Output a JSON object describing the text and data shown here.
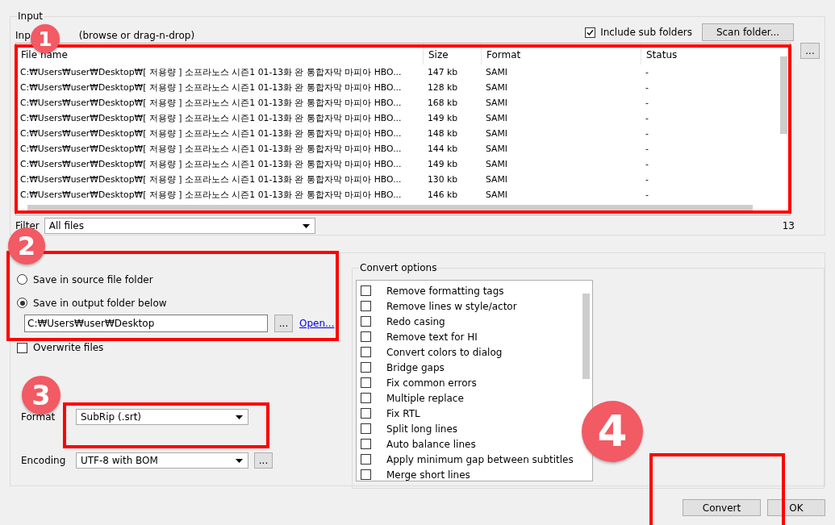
{
  "input": {
    "title": "Input",
    "label_start": "Inp",
    "label_end": "(browse or drag-n-drop)",
    "include_sub_folders": {
      "label": "Include sub folders",
      "checked": true
    },
    "scan_button": "Scan folder...",
    "browse_button": "...",
    "table": {
      "columns": [
        "File name",
        "Size",
        "Format",
        "Status"
      ],
      "rows": [
        {
          "name": "C:₩Users₩user₩Desktop₩[ 저용량 ] 소프라노스 시즌1 01-13화 완 통합자막 마피아 HBO...",
          "size": "147 kb",
          "format": "SAMI",
          "status": "-"
        },
        {
          "name": "C:₩Users₩user₩Desktop₩[ 저용량 ] 소프라노스 시즌1 01-13화 완 통합자막 마피아 HBO...",
          "size": "128 kb",
          "format": "SAMI",
          "status": "-"
        },
        {
          "name": "C:₩Users₩user₩Desktop₩[ 저용량 ] 소프라노스 시즌1 01-13화 완 통합자막 마피아 HBO...",
          "size": "168 kb",
          "format": "SAMI",
          "status": "-"
        },
        {
          "name": "C:₩Users₩user₩Desktop₩[ 저용량 ] 소프라노스 시즌1 01-13화 완 통합자막 마피아 HBO...",
          "size": "149 kb",
          "format": "SAMI",
          "status": "-"
        },
        {
          "name": "C:₩Users₩user₩Desktop₩[ 저용량 ] 소프라노스 시즌1 01-13화 완 통합자막 마피아 HBO...",
          "size": "148 kb",
          "format": "SAMI",
          "status": "-"
        },
        {
          "name": "C:₩Users₩user₩Desktop₩[ 저용량 ] 소프라노스 시즌1 01-13화 완 통합자막 마피아 HBO...",
          "size": "144 kb",
          "format": "SAMI",
          "status": "-"
        },
        {
          "name": "C:₩Users₩user₩Desktop₩[ 저용량 ] 소프라노스 시즌1 01-13화 완 통합자막 마피아 HBO...",
          "size": "149 kb",
          "format": "SAMI",
          "status": "-"
        },
        {
          "name": "C:₩Users₩user₩Desktop₩[ 저용량 ] 소프라노스 시즌1 01-13화 완 통합자막 마피아 HBO...",
          "size": "130 kb",
          "format": "SAMI",
          "status": "-"
        },
        {
          "name": "C:₩Users₩user₩Desktop₩[ 저용량 ] 소프라노스 시즌1 01-13화 완 통합자막 마피아 HBO...",
          "size": "146 kb",
          "format": "SAMI",
          "status": "-"
        }
      ]
    },
    "filter": {
      "label": "Filter",
      "value": "All files"
    },
    "count": "13"
  },
  "output": {
    "radios": [
      {
        "label": "Save in source file folder",
        "selected": false
      },
      {
        "label": "Save in output folder below",
        "selected": true
      }
    ],
    "folder": "C:₩Users₩user₩Desktop",
    "browse_button": "...",
    "open_link": "Open...",
    "overwrite": {
      "label": "Overwrite files",
      "checked": false
    },
    "format": {
      "label": "Format",
      "value": "SubRip (.srt)"
    },
    "encoding": {
      "label": "Encoding",
      "value": "UTF-8 with BOM",
      "button": "..."
    }
  },
  "convert_options": {
    "title": "Convert options",
    "items": [
      {
        "label": "Remove formatting tags",
        "checked": false
      },
      {
        "label": "Remove lines w style/actor",
        "checked": false
      },
      {
        "label": "Redo casing",
        "checked": false
      },
      {
        "label": "Remove text for HI",
        "checked": false
      },
      {
        "label": "Convert colors to dialog",
        "checked": false
      },
      {
        "label": "Bridge gaps",
        "checked": false
      },
      {
        "label": "Fix common errors",
        "checked": false
      },
      {
        "label": "Multiple replace",
        "checked": false
      },
      {
        "label": "Fix RTL",
        "checked": false
      },
      {
        "label": "Split long lines",
        "checked": false
      },
      {
        "label": "Auto balance lines",
        "checked": false
      },
      {
        "label": "Apply minimum gap between subtitles",
        "checked": false
      },
      {
        "label": "Merge short lines",
        "checked": false
      }
    ]
  },
  "buttons": [
    {
      "label": "Convert"
    },
    {
      "label": "OK"
    }
  ],
  "annotations": {
    "badges": [
      {
        "label": "1"
      },
      {
        "label": "2"
      },
      {
        "label": "3"
      },
      {
        "label": "4"
      }
    ]
  }
}
